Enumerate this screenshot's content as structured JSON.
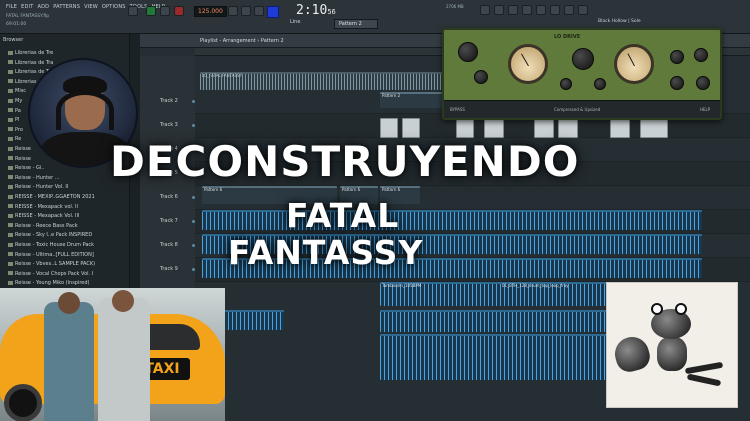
{
  "app": {
    "menu": [
      "FILE",
      "EDIT",
      "ADD",
      "PATTERNS",
      "VIEW",
      "OPTIONS",
      "TOOLS",
      "HELP"
    ],
    "project_title": "FATAL FANTASSY.flp",
    "project_time": "69:01:00",
    "tempo": "125.000",
    "clock_main": "2:10",
    "clock_sub": "56",
    "line_mode": "Line",
    "pattern_selector": "Pattern 2",
    "cpu_label": "2706 MB",
    "hint_text": "Black Hollow | Sole"
  },
  "browser": {
    "title": "Browser",
    "items": [
      "Librerias de Tre",
      "Librerias de Tra",
      "Librerias de Tra",
      "Librerias de Tr",
      "Misc",
      "My",
      "Pa",
      "Pl",
      "Pro",
      "Re",
      "Reisse",
      "Reisse",
      "Reisse - Gi..",
      "Reisse - Hunter ...",
      "Reisse - Hunter Vol. II",
      "REISSE - MEXIP..GGAETON 2021",
      "REISSE - Mexapack vol. II",
      "REISSE - Mexapack Vol. III",
      "Reisse - Reece Bass Pack",
      "Reisse - Sky I..e Pack INSPIRED",
      "Reisse - Toxic House Drum Pack",
      "Reisse - Ultima..[FULL EDITION]",
      "Reisse - Vbves..L SAMPLE PACK)",
      "Reisse - Vocal Chops Pack Vol. I",
      "Reisse - Young Miko (Inspired)"
    ]
  },
  "playlist": {
    "title": "Playlist - Arrangement › Pattern 2",
    "tracks": [
      "Track 2",
      "Track 3",
      "Track 4",
      "Track 5",
      "Track 6",
      "Track 7",
      "Track 8",
      "Track 9"
    ],
    "clips": {
      "top_wave": "LO_FATAL FANTASSY",
      "pattern_a": "Pattern 2",
      "pattern_6a": "Pattern 6",
      "pattern_6b": "Pattern 6",
      "pattern_6c": "Pattern 6",
      "tambourin": "Tambourin_105BPM",
      "drum_loop": "01_BTH_128_drum_top_loop_fray"
    }
  },
  "plugin": {
    "title": "LO DRIVE",
    "footer_left": "BYPASS",
    "footer_center": "Compressed & Upsized",
    "footer_right": "HELP"
  },
  "headline": {
    "line1": "DECONSTRUYENDO",
    "line2": "FATAL",
    "line3": "FANTASSY"
  },
  "photo": {
    "taxi_sign": "TAXI"
  },
  "colors": {
    "accent_orange": "#f28b5b",
    "plugin_green": "#5f7a3a",
    "clip_blue": "#4aa3e0",
    "taxi_yellow": "#f2a319"
  }
}
